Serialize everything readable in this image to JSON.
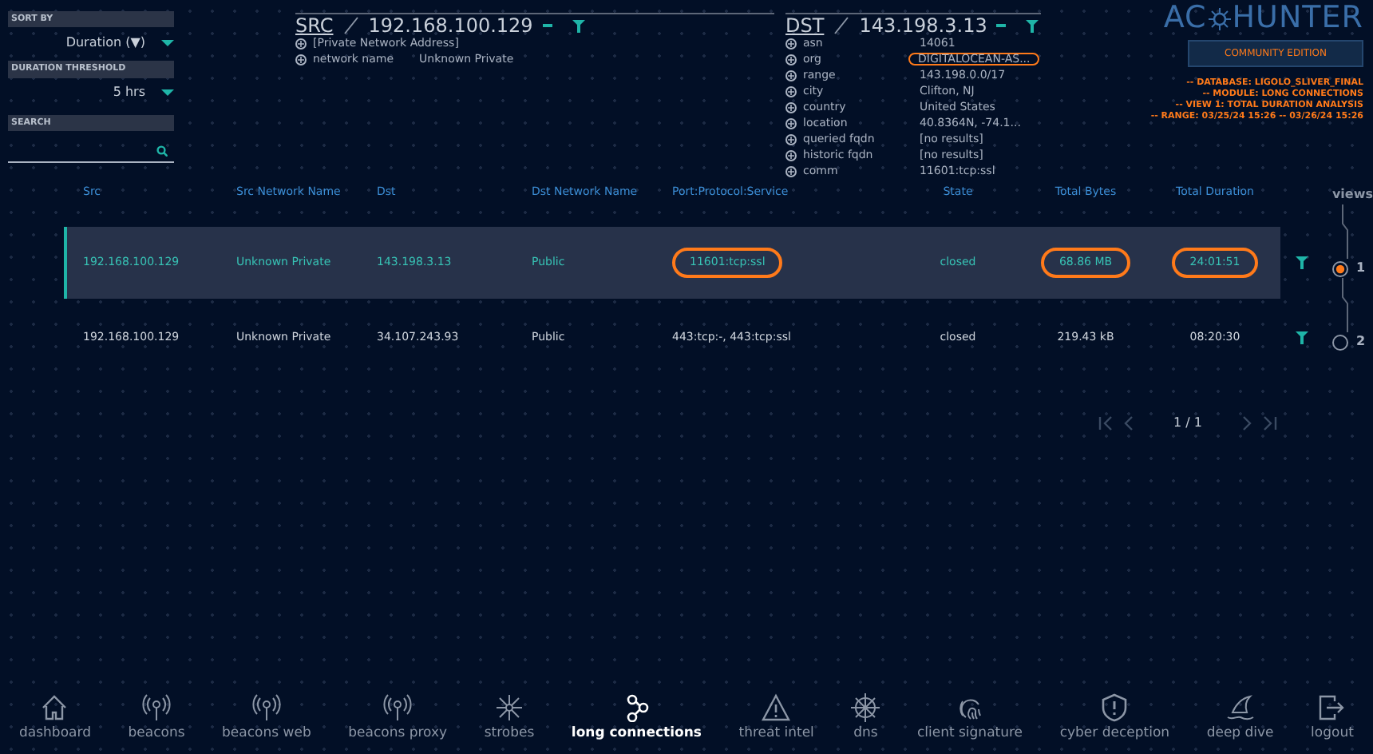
{
  "controls": {
    "sort_by": {
      "label": "SORT BY",
      "value": "Duration (▼)"
    },
    "duration_threshold": {
      "label": "DURATION THRESHOLD",
      "value": "5 hrs"
    },
    "search": {
      "label": "SEARCH"
    }
  },
  "src": {
    "tag": "SRC",
    "address": "192.168.100.129",
    "fields": [
      {
        "value": "[Private Network Address]"
      },
      {
        "label": "network name",
        "value": "Unknown Private"
      }
    ]
  },
  "dst": {
    "tag": "DST",
    "address": "143.198.3.13",
    "fields": [
      {
        "label": "asn",
        "value": "14061",
        "highlighted": false
      },
      {
        "label": "org",
        "value": "DIGITALOCEAN-AS...",
        "highlighted": true
      },
      {
        "label": "range",
        "value": "143.198.0.0/17",
        "highlighted": false
      },
      {
        "label": "city",
        "value": "Clifton, NJ",
        "highlighted": false
      },
      {
        "label": "country",
        "value": "United States",
        "highlighted": false
      },
      {
        "label": "location",
        "value": "40.8364N, -74.1...",
        "highlighted": false
      },
      {
        "label": "queried fqdn",
        "value": "[no results]",
        "highlighted": false
      },
      {
        "label": "historic fqdn",
        "value": "[no results]",
        "highlighted": false
      },
      {
        "label": "comm",
        "value": "11601:tcp:ssl",
        "highlighted": false
      }
    ]
  },
  "logo": {
    "left": "AC",
    "right": "HUNTER",
    "edition": "COMMUNITY EDITION"
  },
  "info_lines": [
    "-- DATABASE: LIGOLO_SLIVER_FINAL",
    "-- MODULE: LONG CONNECTIONS",
    "-- VIEW 1: TOTAL DURATION ANALYSIS",
    "-- RANGE: 03/25/24 15:26 -- 03/26/24 15:26"
  ],
  "table": {
    "columns": [
      "Src",
      "Src Network Name",
      "Dst",
      "Dst Network Name",
      "Port:Protocol:Service",
      "State",
      "Total Bytes",
      "Total Duration"
    ],
    "rows": [
      {
        "selected": true,
        "cells": [
          {
            "text": "192.168.100.129",
            "highlighted": false
          },
          {
            "text": "Unknown Private",
            "highlighted": false
          },
          {
            "text": "143.198.3.13",
            "highlighted": false
          },
          {
            "text": "Public",
            "highlighted": false
          },
          {
            "text": "11601:tcp:ssl",
            "highlighted": true
          },
          {
            "text": "closed",
            "highlighted": false
          },
          {
            "text": "68.86 MB",
            "highlighted": true
          },
          {
            "text": "24:01:51",
            "highlighted": true
          }
        ]
      },
      {
        "selected": false,
        "cells": [
          {
            "text": "192.168.100.129",
            "highlighted": false
          },
          {
            "text": "Unknown Private",
            "highlighted": false
          },
          {
            "text": "34.107.243.93",
            "highlighted": false
          },
          {
            "text": "Public",
            "highlighted": false
          },
          {
            "text": "443:tcp:-, 443:tcp:ssl",
            "highlighted": false
          },
          {
            "text": "closed",
            "highlighted": false
          },
          {
            "text": "219.43 kB",
            "highlighted": false
          },
          {
            "text": "08:20:30",
            "highlighted": false
          }
        ]
      }
    ]
  },
  "pagination": {
    "page": "1 / 1"
  },
  "views": {
    "label": "views",
    "items": [
      {
        "label": "1",
        "selected": true
      },
      {
        "label": "2",
        "selected": false
      }
    ]
  },
  "nav": [
    {
      "label": "dashboard",
      "kind": "house",
      "selected": false
    },
    {
      "label": "beacons",
      "kind": "antenna",
      "selected": false
    },
    {
      "label": "beacons web",
      "kind": "antenna",
      "selected": false
    },
    {
      "label": "beacons proxy",
      "kind": "antenna",
      "selected": false
    },
    {
      "label": "strobes",
      "kind": "burst",
      "selected": false
    },
    {
      "label": "long connections",
      "kind": "nodes",
      "selected": true
    },
    {
      "label": "threat intel",
      "kind": "warning",
      "selected": false
    },
    {
      "label": "dns",
      "kind": "wheel",
      "selected": false
    },
    {
      "label": "client signature",
      "kind": "fingerprint",
      "selected": false
    },
    {
      "label": "cyber deception",
      "kind": "shield",
      "selected": false
    },
    {
      "label": "deep dive",
      "kind": "fin",
      "selected": false
    },
    {
      "label": "logout",
      "kind": "logout",
      "selected": false
    }
  ]
}
